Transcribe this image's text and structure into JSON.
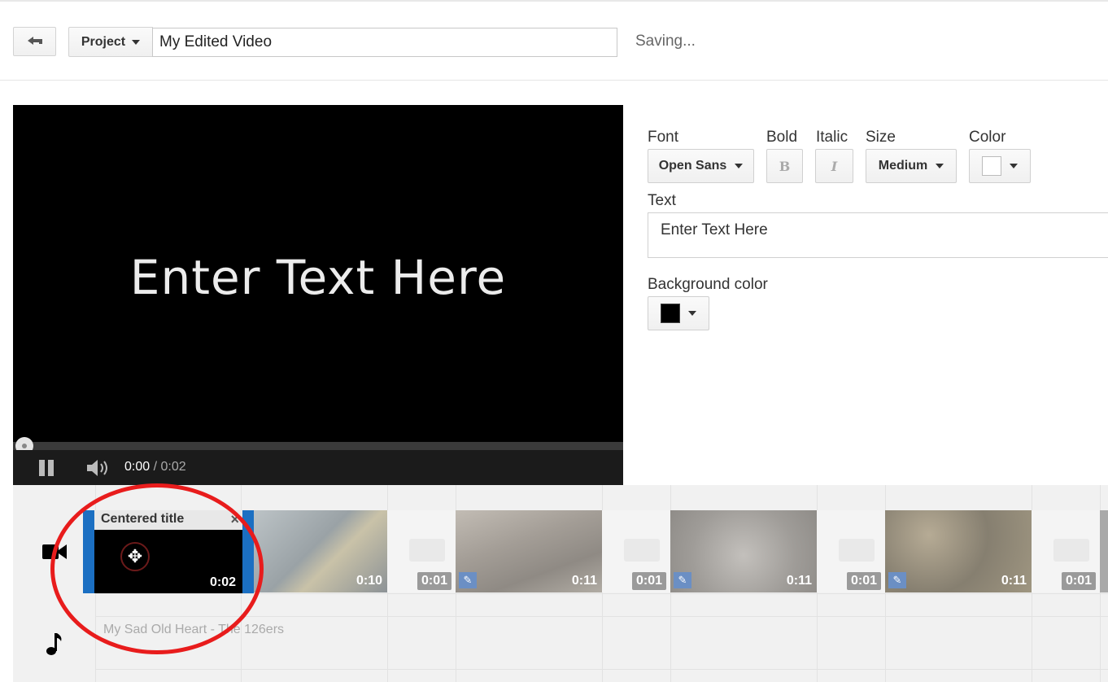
{
  "header": {
    "back_icon": "back-arrow-icon",
    "project_label": "Project",
    "video_title": "My Edited Video",
    "status": "Saving..."
  },
  "player": {
    "overlay_text": "Enter Text Here",
    "current_time": "0:00",
    "duration": "/ 0:02",
    "progress": 0
  },
  "text_settings": {
    "font_label": "Font",
    "font_value": "Open Sans",
    "bold_label": "Bold",
    "bold_glyph": "B",
    "italic_label": "Italic",
    "italic_glyph": "I",
    "size_label": "Size",
    "size_value": "Medium",
    "color_label": "Color",
    "color_value": "#ffffff",
    "text_label": "Text",
    "text_value": "Enter Text Here",
    "bg_label": "Background color",
    "bg_value": "#000000"
  },
  "timeline": {
    "video_track_icon": "video-camera-icon",
    "audio_track_icon": "music-note-icon",
    "selected_clip": {
      "title": "Centered title",
      "close": "×",
      "duration": "0:02"
    },
    "clips": [
      {
        "type": "thumb",
        "duration": "0:10"
      },
      {
        "type": "transition",
        "duration": "0:01"
      },
      {
        "type": "thumb",
        "duration": "0:11"
      },
      {
        "type": "transition",
        "duration": "0:01"
      },
      {
        "type": "thumb",
        "duration": "0:11"
      },
      {
        "type": "transition",
        "duration": "0:01"
      },
      {
        "type": "thumb",
        "duration": "0:11"
      },
      {
        "type": "transition",
        "duration": "0:01"
      }
    ],
    "audio_track_label": "My Sad Old Heart - The 126ers"
  }
}
